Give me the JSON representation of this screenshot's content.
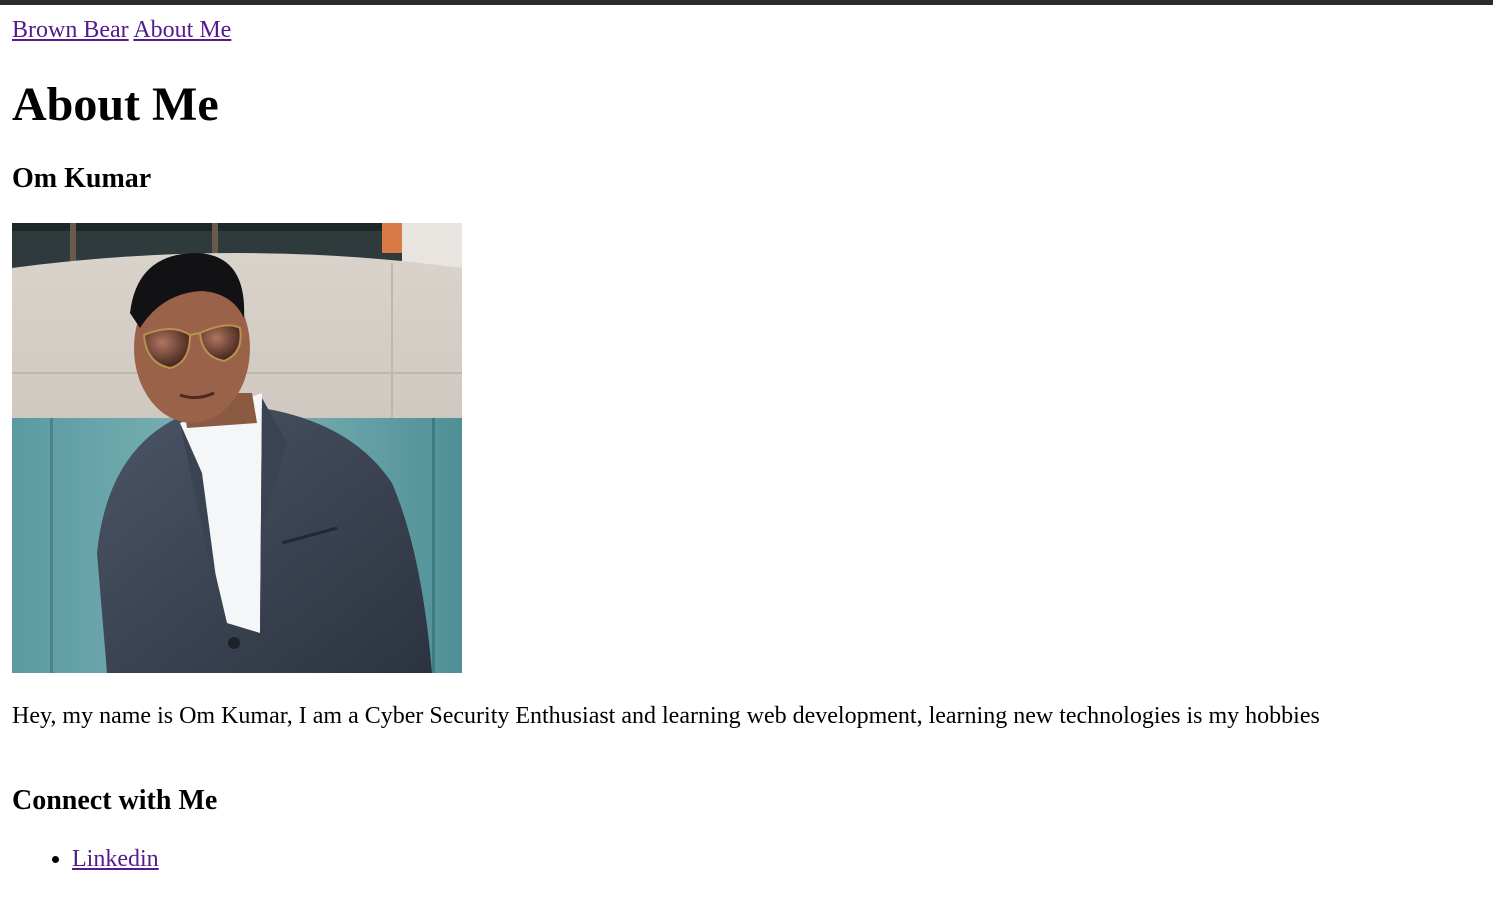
{
  "nav": {
    "home_label": "Brown Bear",
    "about_label": "About Me"
  },
  "page_title": "About Me",
  "profile": {
    "name": "Om Kumar",
    "photo_icon": "profile-photo",
    "bio": "Hey, my name is Om Kumar, I am a Cyber Security Enthusiast and learning web development, learning new technologies is my hobbies"
  },
  "connect": {
    "heading": "Connect with Me",
    "links": [
      {
        "label": "Linkedin"
      }
    ]
  },
  "colors": {
    "link_visited": "#551a8b",
    "text": "#000000",
    "background": "#ffffff",
    "top_strip": "#2b2b2f"
  }
}
